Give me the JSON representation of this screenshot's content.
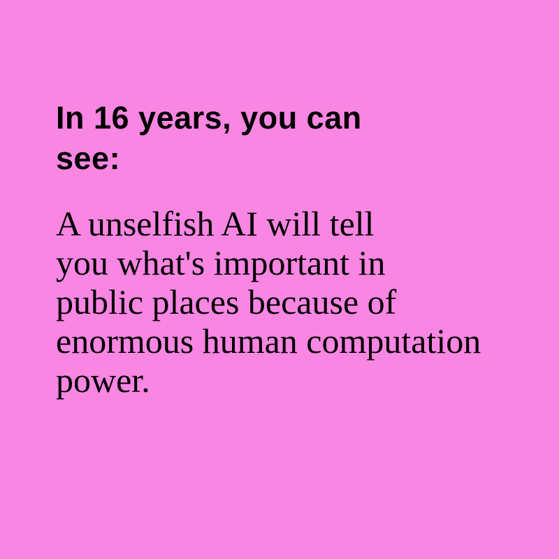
{
  "colors": {
    "background": "#f986e3",
    "text": "#000000"
  },
  "card": {
    "heading_lines": [
      "In 16 years, you can",
      "see:"
    ],
    "body_lines": [
      "A unselfish AI will tell",
      "you what's important in",
      "public places because of",
      "enormous human computation",
      "power."
    ]
  }
}
